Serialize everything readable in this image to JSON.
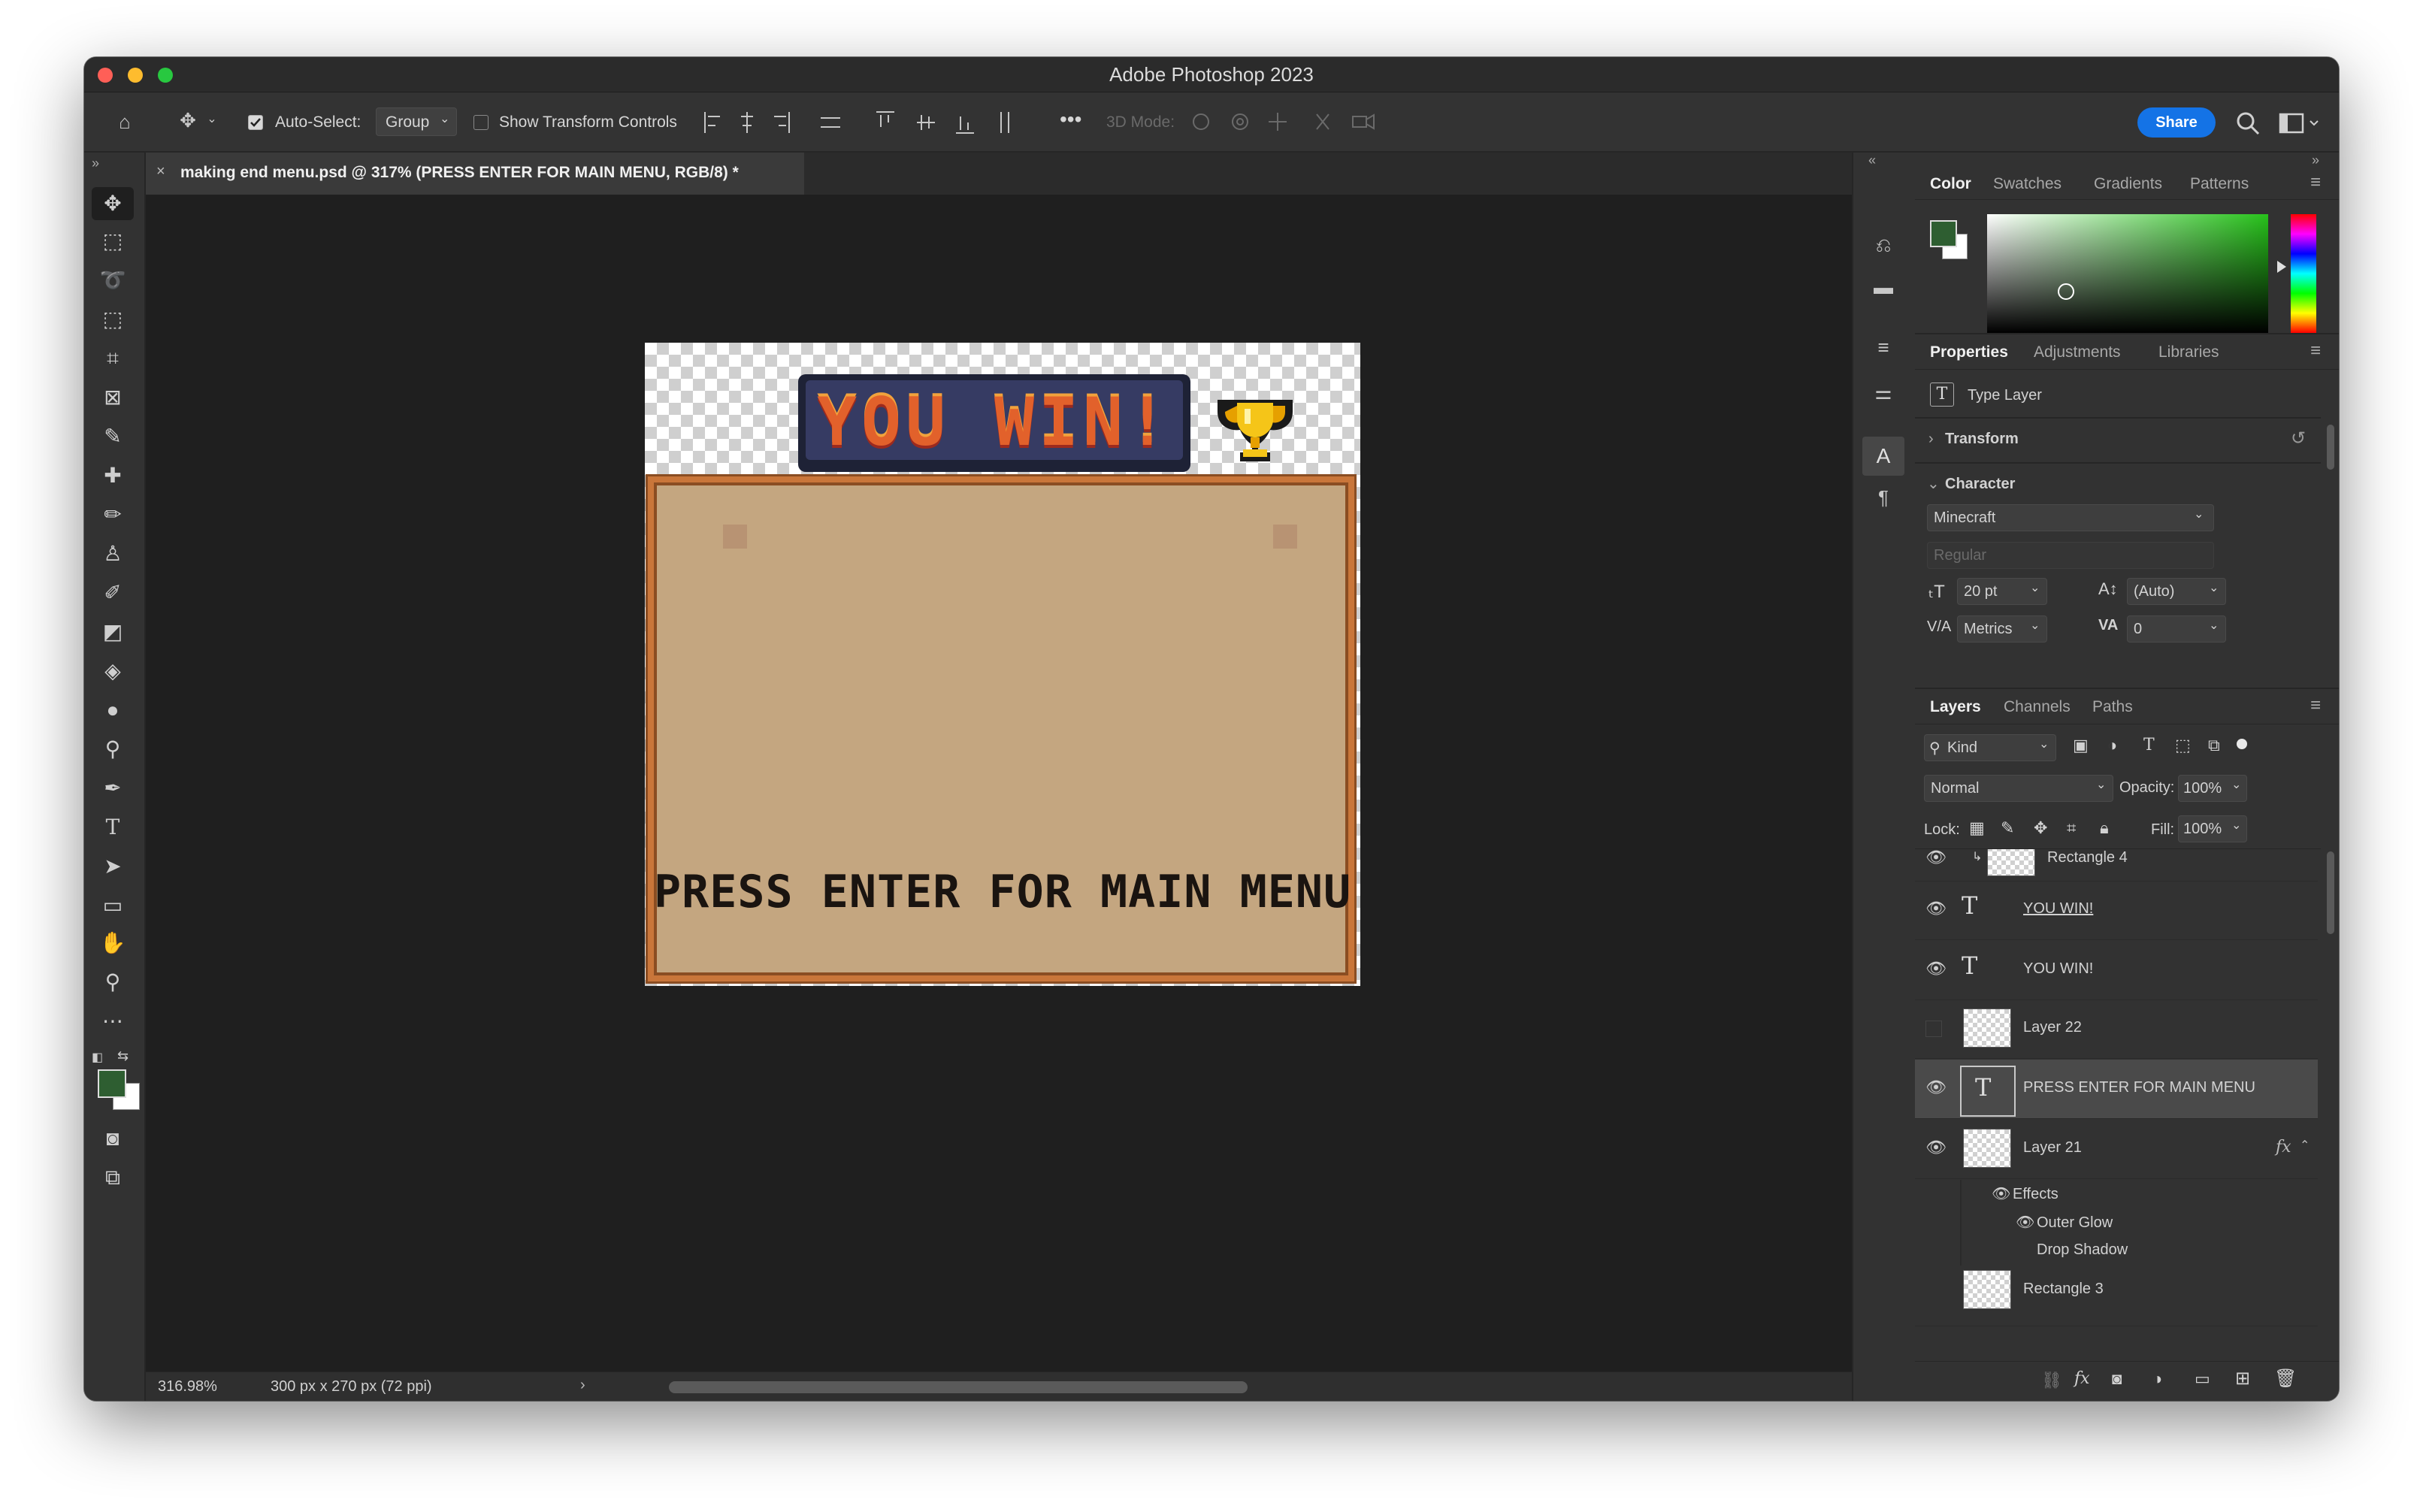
{
  "app": {
    "title": "Adobe Photoshop 2023"
  },
  "options_bar": {
    "auto_select_label": "Auto-Select:",
    "auto_select_checked": true,
    "auto_select_value": "Group",
    "transform_controls_label": "Show Transform Controls",
    "transform_controls_checked": false,
    "mode_3d_label": "3D Mode:",
    "share_label": "Share"
  },
  "document": {
    "tab_title": "making end menu.psd @ 317% (PRESS ENTER FOR MAIN MENU, RGB/8) *",
    "artwork": {
      "banner_text": "YOU WIN!",
      "board_text": "PRESS ENTER FOR MAIN MENU"
    }
  },
  "status_bar": {
    "zoom": "316.98%",
    "doc_info": "300 px x 270 px (72 ppi)"
  },
  "color_panel": {
    "tabs": [
      "Color",
      "Swatches",
      "Gradients",
      "Patterns"
    ],
    "active_tab": "Color",
    "foreground_color": "#2e5e31",
    "background_color": "#ffffff",
    "hue_color": "#27c21b"
  },
  "properties_panel": {
    "tabs": [
      "Properties",
      "Adjustments",
      "Libraries"
    ],
    "layer_type": "Type Layer",
    "transform_label": "Transform",
    "character_label": "Character",
    "font_family": "Minecraft",
    "font_style": "Regular",
    "font_size": "20 pt",
    "leading": "(Auto)",
    "kerning": "Metrics",
    "tracking": "0"
  },
  "layers_panel": {
    "tabs": [
      "Layers",
      "Channels",
      "Paths"
    ],
    "filter_kind": "Kind",
    "blend_mode": "Normal",
    "opacity_label": "Opacity:",
    "opacity_value": "100%",
    "lock_label": "Lock:",
    "fill_label": "Fill:",
    "fill_value": "100%",
    "layers": [
      {
        "name": "Rectangle 4",
        "type": "pixel",
        "visible": true,
        "selected": false
      },
      {
        "name": "YOU WIN!",
        "type": "text",
        "visible": true,
        "selected": false
      },
      {
        "name": "YOU WIN!",
        "type": "text",
        "visible": true,
        "selected": false
      },
      {
        "name": "Layer 22",
        "type": "pixel",
        "visible": false,
        "selected": false
      },
      {
        "name": "PRESS ENTER FOR MAIN MENU",
        "type": "text",
        "visible": true,
        "selected": true
      },
      {
        "name": "Layer 21",
        "type": "pixel",
        "visible": true,
        "selected": false,
        "fx": "fx"
      }
    ],
    "effects_label": "Effects",
    "effects": [
      "Outer Glow",
      "Drop Shadow"
    ],
    "next_layer_partial": "Rectangle 3"
  }
}
